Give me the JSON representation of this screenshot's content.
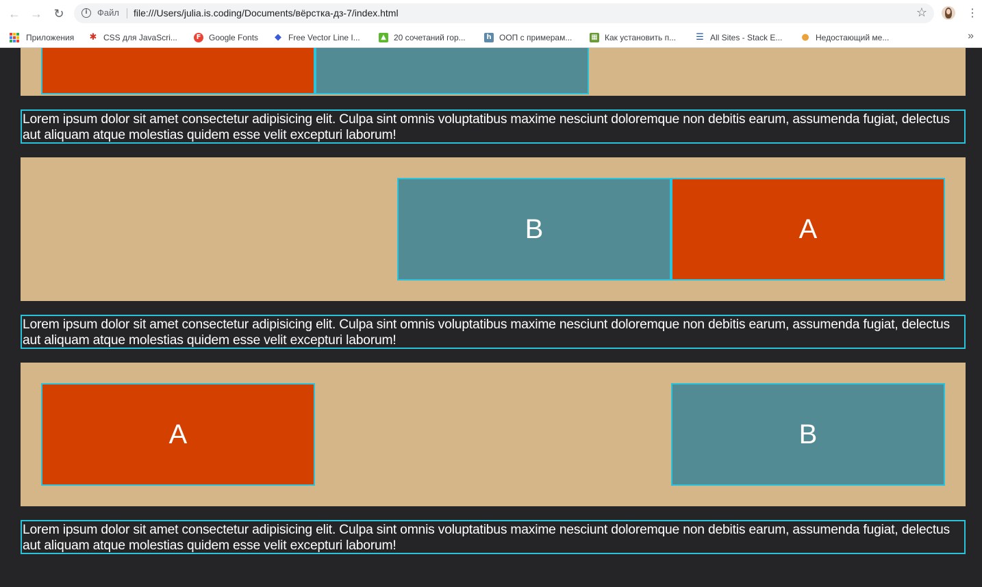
{
  "browser": {
    "scheme_label": "Файл",
    "url": "file:///Users/julia.is.coding/Documents/вёрстка-дз-7/index.html",
    "icons": {
      "back": "arrow-back-icon",
      "forward": "arrow-forward-icon",
      "reload": "reload-icon",
      "info": "info-icon",
      "star": "star-icon",
      "menu": "kebab-menu-icon"
    },
    "bookmarks": [
      {
        "label": "Приложения",
        "icon": "apps-grid-icon"
      },
      {
        "label": "CSS для JavaScri...",
        "icon": "figure-icon",
        "color": "#d93025"
      },
      {
        "label": "Google Fonts",
        "icon": "google-fonts-icon",
        "color": "#ea4335"
      },
      {
        "label": "Free Vector Line I...",
        "icon": "diamond-icon",
        "color": "#3b5bdb"
      },
      {
        "label": "20 сочетаний гор...",
        "icon": "green-figure-icon",
        "color": "#5cb82e"
      },
      {
        "label": "ООП с примерам...",
        "icon": "habr-icon",
        "color": "#5d8aa8"
      },
      {
        "label": "Как установить п...",
        "icon": "book-icon",
        "color": "#6b9b37"
      },
      {
        "label": "All Sites - Stack E...",
        "icon": "stack-exchange-icon",
        "color": "#1e5397"
      },
      {
        "label": "Недостающий ме...",
        "icon": "lightbulb-icon",
        "color": "#e8a33c"
      }
    ],
    "more_icon": "chevron-double-right-icon"
  },
  "content": {
    "container_bg": "#d5b688",
    "page_bg": "#252527",
    "box_a_color": "#d44000",
    "box_b_color": "#528b93",
    "outline_color": "#2bc3dc",
    "section2": {
      "box_b": "B",
      "box_a": "A"
    },
    "section3": {
      "box_a": "A",
      "box_b": "B"
    },
    "lorem": "Lorem ipsum dolor sit amet consectetur adipisicing elit. Culpa sint omnis voluptatibus maxime nesciunt doloremque non debitis earum, assumenda fugiat, delectus aut aliquam atque molestias quidem esse velit excepturi laborum!"
  }
}
